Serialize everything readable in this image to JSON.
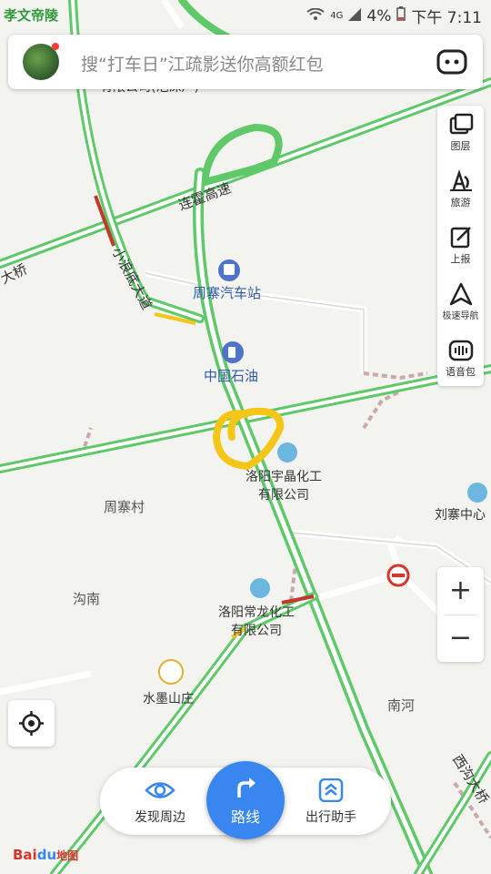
{
  "status_bar": {
    "carrier_text": "孝文帝陵",
    "network": "4G",
    "battery": "4%",
    "time": "下午 7:11"
  },
  "search": {
    "placeholder": "搜“打车日”江疏影送你高额红包"
  },
  "map_labels": {
    "top_poi": "洛阳市东大伟业贸有限公司(泡沫厂)",
    "top_poi_line2": "有限公司(泡沫厂)",
    "highway": "连霍高速",
    "bridge_left": "大桥",
    "avenue": "小浪底大道",
    "bus_station": "周寨汽车站",
    "gas_station": "中国石油",
    "chem1_line1": "洛阳宇晶化工",
    "chem1_line2": "有限公司",
    "village1": "周寨村",
    "liuzhai": "刘寨中心",
    "gounan": "沟南",
    "chem2_line1": "洛阳常龙化工",
    "chem2_line2": "有限公司",
    "shuimo": "水墨山庄",
    "nanhe": "南河",
    "bridge_right": "西沟大桥"
  },
  "tools": [
    {
      "label": "图层",
      "icon": "layers-icon"
    },
    {
      "label": "旅游",
      "icon": "travel-icon"
    },
    {
      "label": "上报",
      "icon": "report-icon"
    },
    {
      "label": "极速导航",
      "icon": "navigation-icon"
    },
    {
      "label": "语音包",
      "icon": "voice-pack-icon"
    }
  ],
  "zoom": {
    "in": "+",
    "out": "−"
  },
  "bottom": {
    "discover": "发现周边",
    "route": "路线",
    "assistant": "出行助手"
  },
  "logo": {
    "text": "Bai地图"
  },
  "colors": {
    "road_green": "#5fc96a",
    "accent_blue": "#3a86f0",
    "highlight_yellow": "#f5c518",
    "congestion_red": "#c0392b"
  }
}
